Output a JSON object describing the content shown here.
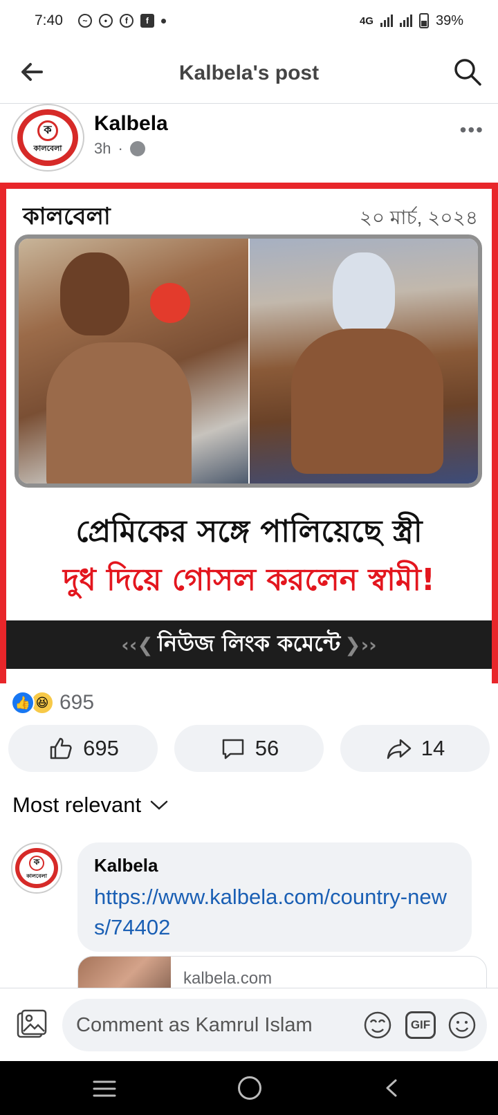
{
  "status_bar": {
    "time": "7:40",
    "network": "4G",
    "battery": "39%"
  },
  "header": {
    "title": "Kalbela's post"
  },
  "post": {
    "page_name": "Kalbela",
    "time": "3h",
    "separator": "·",
    "more": "•••",
    "image": {
      "brand": "কালবেলা",
      "date": "২০ মার্চ, ২০২৪",
      "headline_line1": "প্রেমিকের সঙ্গে পালিয়েছে স্ত্রী",
      "headline_line2": "দুধ দিয়ে গোসল করলেন স্বামী!",
      "banner": "নিউজ লিংক কমেন্টে",
      "banner_left": "‹‹❮",
      "banner_right": "❯››"
    },
    "reaction_count": "695",
    "actions": {
      "like_count": "695",
      "comment_count": "56",
      "share_count": "14"
    }
  },
  "comments": {
    "sort_label": "Most relevant",
    "items": [
      {
        "author": "Kalbela",
        "text": "https://www.kalbela.com/country-news/74402",
        "preview_domain": "kalbela.com"
      }
    ]
  },
  "composer": {
    "placeholder": "Comment as Kamrul Islam",
    "gif_label": "GIF"
  },
  "colors": {
    "brand_red": "#e3161e",
    "facebook_blue": "#1877f2",
    "link_blue": "#1a5fb4"
  }
}
